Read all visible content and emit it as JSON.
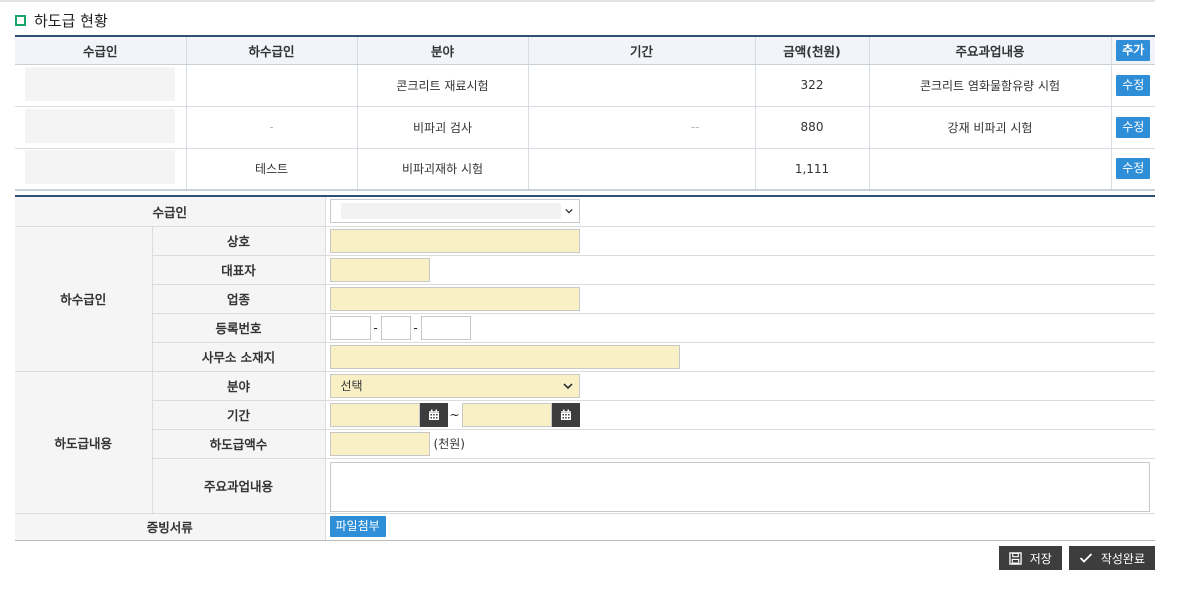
{
  "section": {
    "title": "하도급 현황"
  },
  "list": {
    "headers": [
      "수급인",
      "하수급인",
      "분야",
      "기간",
      "금액(천원)",
      "주요과업내용"
    ],
    "add_label": "추가",
    "edit_label": "수정",
    "rows": [
      {
        "contractor": "",
        "subcontractor": "",
        "field": "콘크리트 재료시험",
        "period": "",
        "amount": "322",
        "task": "콘크리트 염화물함유량 시험"
      },
      {
        "contractor": "",
        "subcontractor": "-",
        "field": "비파괴 검사",
        "period": "--",
        "amount": "880",
        "task": "강재 비파괴 시험"
      },
      {
        "contractor": "",
        "subcontractor": "테스트",
        "field": "비파괴재하 시험",
        "period": "",
        "amount": "1,111",
        "task": ""
      }
    ]
  },
  "form": {
    "contractor_label": "수급인",
    "subcontractor_group": "하수급인",
    "company_label": "상호",
    "ceo_label": "대표자",
    "business_label": "업종",
    "regno_label": "등록번호",
    "office_label": "사무소 소재지",
    "content_group": "하도급내용",
    "field_label": "분야",
    "field_selected": "선택",
    "period_label": "기간",
    "period_sep": "~",
    "amount_label": "하도급액수",
    "amount_unit": "(천원)",
    "task_label": "주요과업내용",
    "docs_label": "증빙서류",
    "attach_label": "파일첨부",
    "regno_sep": "-"
  },
  "buttons": {
    "save": "저장",
    "complete": "작성완료"
  }
}
